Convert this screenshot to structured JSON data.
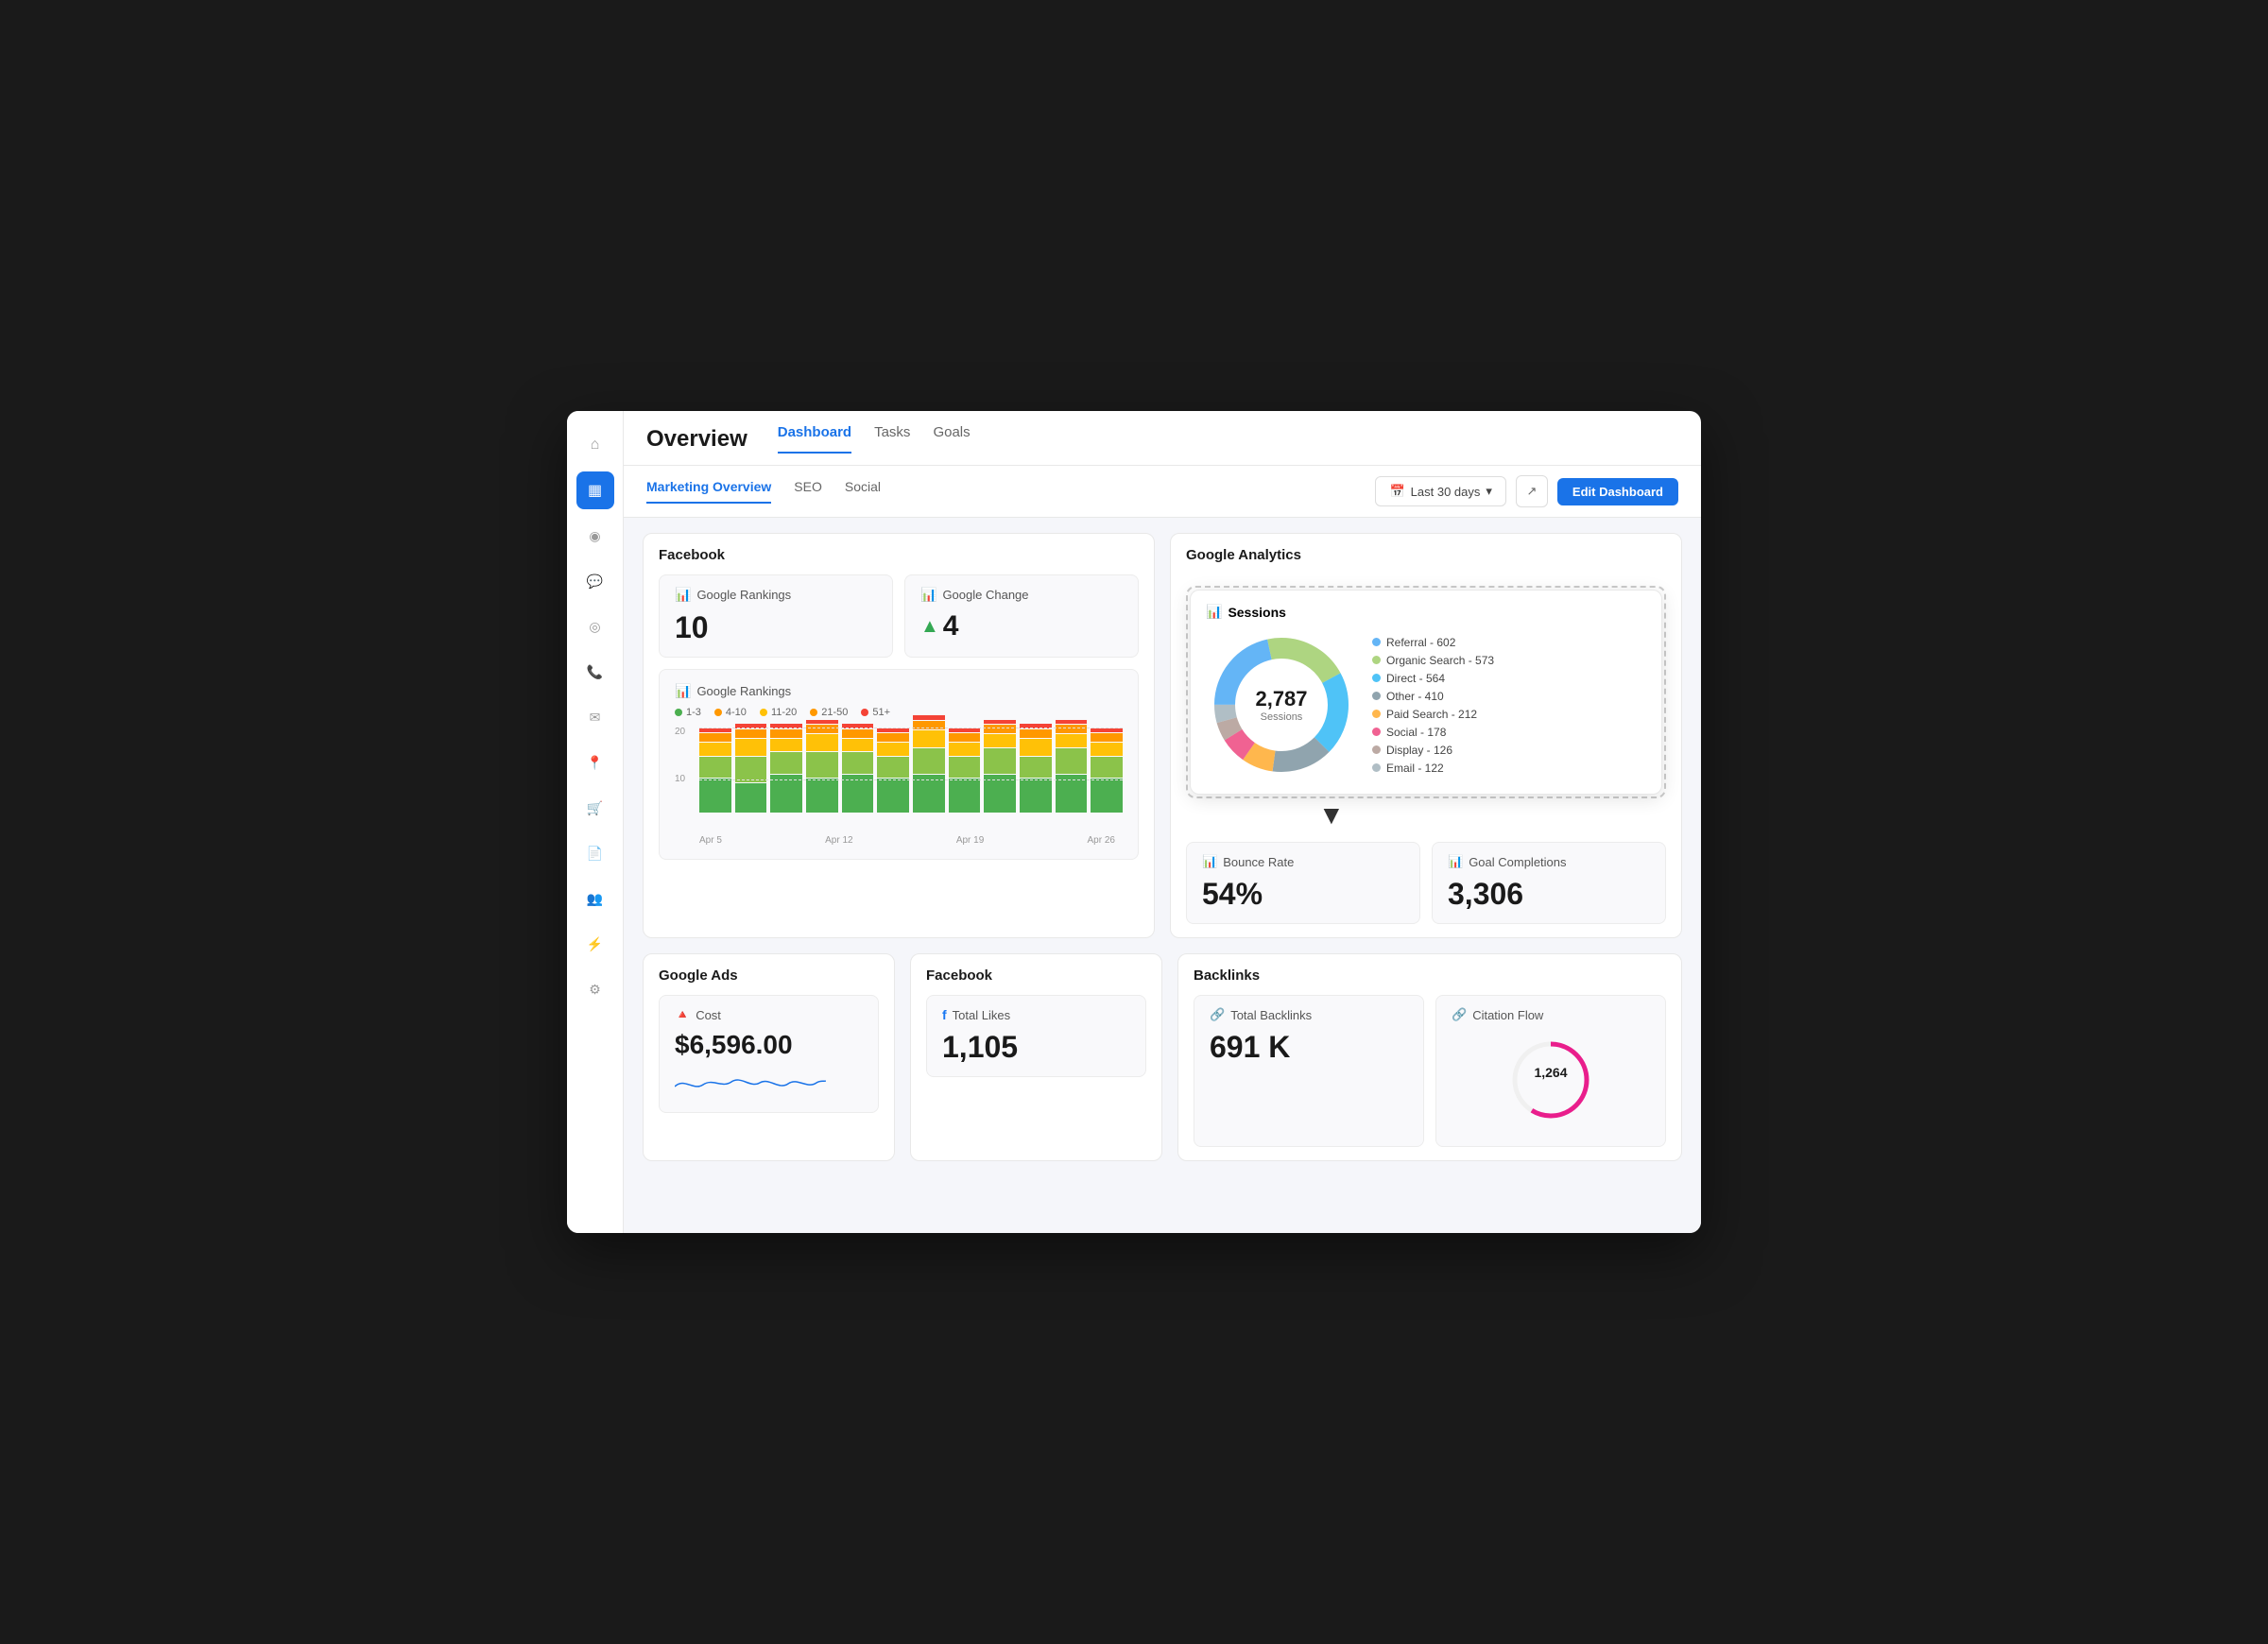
{
  "sidebar": {
    "items": [
      {
        "icon": "⌂",
        "name": "home",
        "active": false
      },
      {
        "icon": "▦",
        "name": "dashboard",
        "active": true
      },
      {
        "icon": "◉",
        "name": "analytics",
        "active": false
      },
      {
        "icon": "💬",
        "name": "messages",
        "active": false
      },
      {
        "icon": "◎",
        "name": "target",
        "active": false
      },
      {
        "icon": "📞",
        "name": "phone",
        "active": false
      },
      {
        "icon": "✉",
        "name": "email",
        "active": false
      },
      {
        "icon": "📍",
        "name": "location",
        "active": false
      },
      {
        "icon": "🛒",
        "name": "cart",
        "active": false
      },
      {
        "icon": "📄",
        "name": "document",
        "active": false
      },
      {
        "icon": "👥",
        "name": "users",
        "active": false
      },
      {
        "icon": "⚡",
        "name": "integrations",
        "active": false
      },
      {
        "icon": "⚙",
        "name": "settings",
        "active": false
      }
    ]
  },
  "header": {
    "title": "Overview",
    "nav_tabs": [
      {
        "label": "Dashboard",
        "active": true
      },
      {
        "label": "Tasks",
        "active": false
      },
      {
        "label": "Goals",
        "active": false
      }
    ]
  },
  "sub_nav": {
    "tabs": [
      {
        "label": "Marketing Overview",
        "active": true
      },
      {
        "label": "SEO",
        "active": false
      },
      {
        "label": "Social",
        "active": false
      }
    ],
    "date_filter": "Last 30 days",
    "edit_label": "Edit Dashboard"
  },
  "facebook_section": {
    "title": "Facebook",
    "google_rankings_card": {
      "label": "Google Rankings",
      "value": "10"
    },
    "google_change_card": {
      "label": "Google Change",
      "value": "4",
      "arrow": "▲"
    }
  },
  "chart_section": {
    "title": "Google Rankings",
    "legend": [
      {
        "label": "1-3",
        "color": "#4caf50"
      },
      {
        "label": "4-10",
        "color": "#ff9800"
      },
      {
        "label": "11-20",
        "color": "#ffc107"
      },
      {
        "label": "21-50",
        "color": "#ff9800"
      },
      {
        "label": "51+",
        "color": "#f44336"
      }
    ],
    "y_labels": [
      "20",
      "10",
      ""
    ],
    "x_labels": [
      "Apr 5",
      "Apr 12",
      "Apr 19",
      "Apr 26"
    ],
    "bars": [
      {
        "segments": [
          8,
          5,
          3,
          2,
          1
        ]
      },
      {
        "segments": [
          7,
          6,
          4,
          2,
          1
        ]
      },
      {
        "segments": [
          9,
          5,
          3,
          2,
          1
        ]
      },
      {
        "segments": [
          8,
          6,
          4,
          2,
          1
        ]
      },
      {
        "segments": [
          9,
          5,
          3,
          2,
          1
        ]
      },
      {
        "segments": [
          8,
          5,
          3,
          2,
          1
        ]
      },
      {
        "segments": [
          9,
          6,
          4,
          2,
          1
        ]
      },
      {
        "segments": [
          8,
          5,
          3,
          2,
          1
        ]
      },
      {
        "segments": [
          9,
          6,
          3,
          2,
          1
        ]
      },
      {
        "segments": [
          8,
          5,
          4,
          2,
          1
        ]
      },
      {
        "segments": [
          9,
          6,
          3,
          2,
          1
        ]
      },
      {
        "segments": [
          8,
          5,
          3,
          2,
          1
        ]
      }
    ]
  },
  "google_analytics": {
    "title": "Google Analytics",
    "sessions": {
      "title": "Sessions",
      "total": "2,787",
      "sublabel": "Sessions",
      "legend": [
        {
          "label": "Referral - 602",
          "color": "#64b5f6"
        },
        {
          "label": "Organic Search - 573",
          "color": "#aed581"
        },
        {
          "label": "Direct - 564",
          "color": "#4fc3f7"
        },
        {
          "label": "Other - 410",
          "color": "#90a4ae"
        },
        {
          "label": "Paid Search - 212",
          "color": "#ffb74d"
        },
        {
          "label": "Social - 178",
          "color": "#f06292"
        },
        {
          "label": "Display - 126",
          "color": "#bcaaa4"
        },
        {
          "label": "Email - 122",
          "color": "#b0bec5"
        }
      ],
      "donut_segments": [
        {
          "value": 602,
          "color": "#64b5f6"
        },
        {
          "value": 573,
          "color": "#aed581"
        },
        {
          "value": 564,
          "color": "#4fc3f7"
        },
        {
          "value": 410,
          "color": "#90a4ae"
        },
        {
          "value": 212,
          "color": "#ffb74d"
        },
        {
          "value": 178,
          "color": "#f06292"
        },
        {
          "value": 126,
          "color": "#bcaaa4"
        },
        {
          "value": 122,
          "color": "#b0bec5"
        }
      ]
    },
    "bounce_rate": {
      "label": "Bounce Rate",
      "value": "54%"
    },
    "goal_completions": {
      "label": "Goal Completions",
      "value": "3,306"
    }
  },
  "google_ads": {
    "title": "Google Ads",
    "cost": {
      "label": "Cost",
      "value": "$6,596.00"
    }
  },
  "facebook_bottom": {
    "title": "Facebook",
    "total_likes": {
      "label": "Total Likes",
      "value": "1,105"
    }
  },
  "backlinks": {
    "title": "Backlinks",
    "total_backlinks": {
      "label": "Total Backlinks",
      "value": "691 K"
    },
    "citation_flow": {
      "label": "Citation Flow",
      "value": "1,264",
      "ring_color": "#e91e8c"
    }
  }
}
